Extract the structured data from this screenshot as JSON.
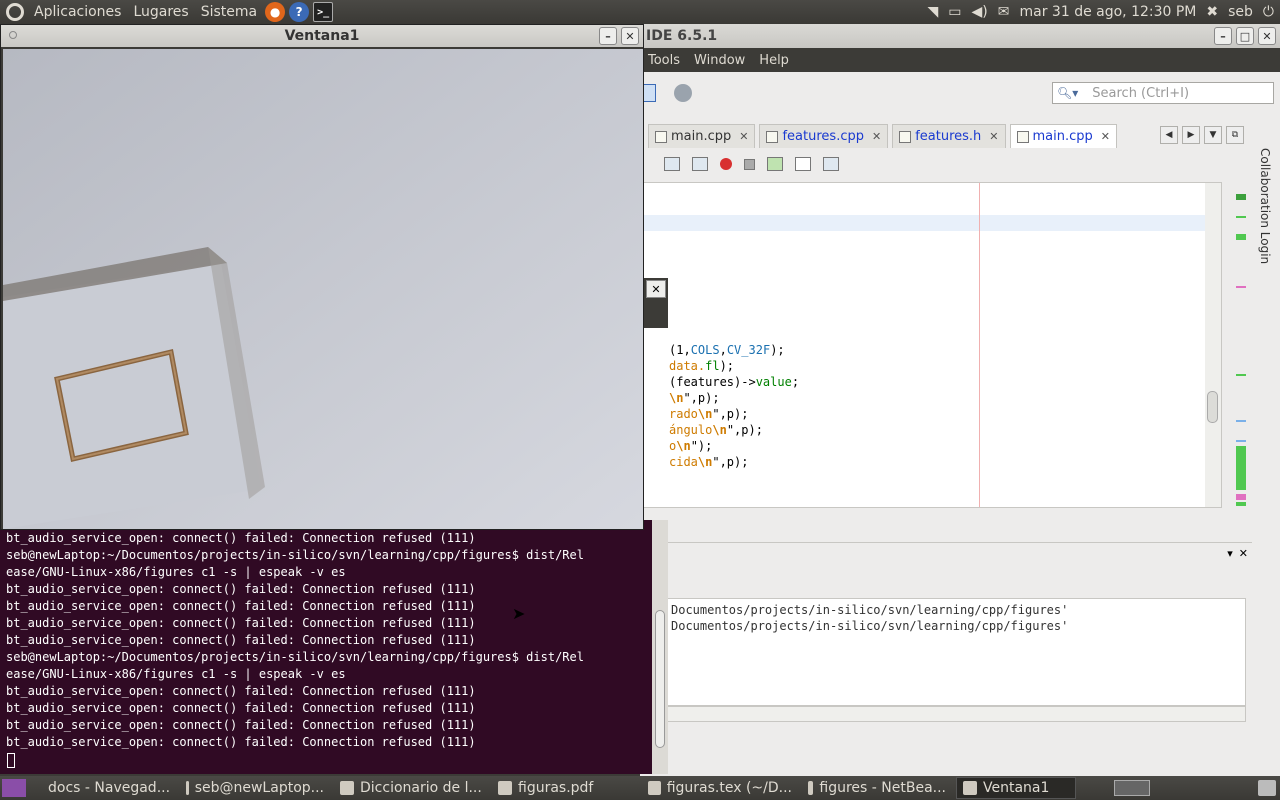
{
  "top_panel": {
    "menus": [
      "Aplicaciones",
      "Lugares",
      "Sistema"
    ],
    "clock": "mar 31 de ago, 12:30 PM",
    "user": "seb"
  },
  "camera_window": {
    "title": "Ventana1"
  },
  "netbeans": {
    "title": "IDE 6.5.1",
    "menu": [
      "Tools",
      "Window",
      "Help"
    ],
    "search_placeholder": "Search (Ctrl+I)",
    "tabs": [
      {
        "label": "main.cpp",
        "active": false,
        "modified": false
      },
      {
        "label": "features.cpp",
        "active": false,
        "modified": true
      },
      {
        "label": "features.h",
        "active": false,
        "modified": true
      },
      {
        "label": "main.cpp",
        "active": true,
        "modified": false
      }
    ],
    "side_label": "Collaboration Login",
    "code_lines": [
      {
        "parts": [
          {
            "t": "(1,",
            "c": ""
          },
          {
            "t": "COLS",
            "c": "kw"
          },
          {
            "t": ",",
            "c": ""
          },
          {
            "t": "CV_32F",
            "c": "kw"
          },
          {
            "t": ");",
            "c": ""
          }
        ]
      },
      {
        "parts": [
          {
            "t": "data.",
            "c": "str"
          },
          {
            "t": "fl",
            "c": "fld"
          },
          {
            "t": ");",
            "c": ""
          }
        ]
      },
      {
        "parts": [
          {
            "t": "(features)->",
            "c": ""
          },
          {
            "t": "value",
            "c": "fld"
          },
          {
            "t": ";",
            "c": ""
          }
        ]
      },
      {
        "parts": [
          {
            "t": "\\n",
            "c": "esc"
          },
          {
            "t": "\",p);",
            "c": ""
          }
        ]
      },
      {
        "parts": [
          {
            "t": "rado",
            "c": "str"
          },
          {
            "t": "\\n",
            "c": "esc"
          },
          {
            "t": "\",p);",
            "c": ""
          }
        ]
      },
      {
        "parts": [
          {
            "t": "ángulo",
            "c": "str"
          },
          {
            "t": "\\n",
            "c": "esc"
          },
          {
            "t": "\",p);",
            "c": ""
          }
        ]
      },
      {
        "parts": [
          {
            "t": "o",
            "c": "str"
          },
          {
            "t": "\\n",
            "c": "esc"
          },
          {
            "t": "\");",
            "c": ""
          }
        ]
      },
      {
        "parts": [
          {
            "t": "cida",
            "c": "str"
          },
          {
            "t": "\\n",
            "c": "esc"
          },
          {
            "t": "\",p);",
            "c": ""
          }
        ]
      }
    ],
    "output_lines": [
      "Documentos/projects/in-silico/svn/learning/cpp/figures'",
      "Documentos/projects/in-silico/svn/learning/cpp/figures'"
    ]
  },
  "terminal": {
    "lines": [
      "bt_audio_service_open: connect() failed: Connection refused (111)",
      "seb@newLaptop:~/Documentos/projects/in-silico/svn/learning/cpp/figures$ dist/Rel",
      "ease/GNU-Linux-x86/figures c1 -s | espeak -v es",
      "bt_audio_service_open: connect() failed: Connection refused (111)",
      "bt_audio_service_open: connect() failed: Connection refused (111)",
      "bt_audio_service_open: connect() failed: Connection refused (111)",
      "bt_audio_service_open: connect() failed: Connection refused (111)",
      "seb@newLaptop:~/Documentos/projects/in-silico/svn/learning/cpp/figures$ dist/Rel",
      "ease/GNU-Linux-x86/figures c1 -s | espeak -v es",
      "bt_audio_service_open: connect() failed: Connection refused (111)",
      "bt_audio_service_open: connect() failed: Connection refused (111)",
      "bt_audio_service_open: connect() failed: Connection refused (111)",
      "bt_audio_service_open: connect() failed: Connection refused (111)"
    ]
  },
  "taskbar": {
    "items": [
      {
        "label": "docs - Navegad...",
        "icon": "folder-icon",
        "active": false
      },
      {
        "label": "seb@newLaptop...",
        "icon": "terminal-icon",
        "active": false
      },
      {
        "label": "Diccionario de l...",
        "icon": "browser-icon",
        "active": false
      },
      {
        "label": "figuras.pdf",
        "icon": "pdf-icon",
        "active": false
      },
      {
        "label": "figuras.tex (~/D...",
        "icon": "editor-icon",
        "active": false
      },
      {
        "label": "figures - NetBea...",
        "icon": "netbeans-icon",
        "active": false
      },
      {
        "label": "Ventana1",
        "icon": "window-icon",
        "active": true
      }
    ]
  },
  "colors": {
    "panel": "#3c3b37",
    "terminal_bg": "#300a24",
    "link_tab": "#1a3ad0"
  }
}
